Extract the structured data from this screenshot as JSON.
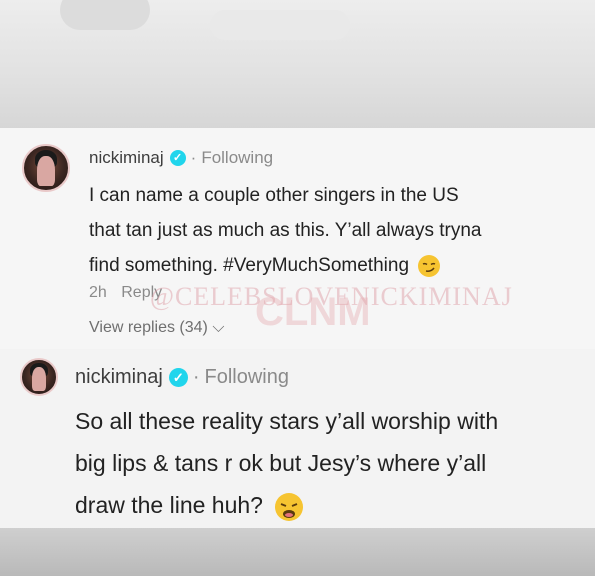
{
  "comment1": {
    "username": "nickiminaj",
    "following": "Following",
    "lines": [
      "I can name a couple other singers in the US",
      "that tan just as much as this. Y’all always tryna",
      "find something. #VeryMuchSomething"
    ],
    "emoji": "smirking-face",
    "time": "2h",
    "reply": "Reply",
    "view_replies": "View replies (34)"
  },
  "comment2": {
    "username": "nickiminaj",
    "following": "Following",
    "lines": [
      "So all these reality stars y’all worship with",
      "big lips & tans r ok but Jesy’s where y’all",
      "draw the line huh?"
    ],
    "emoji": "weary-face"
  },
  "watermark": {
    "text": "@CELEBSLOVENICKIMINAJ",
    "logo": "CLNM"
  },
  "colors": {
    "verified": "#20d5ec",
    "text": "#222222",
    "muted": "#8a8a8a"
  }
}
